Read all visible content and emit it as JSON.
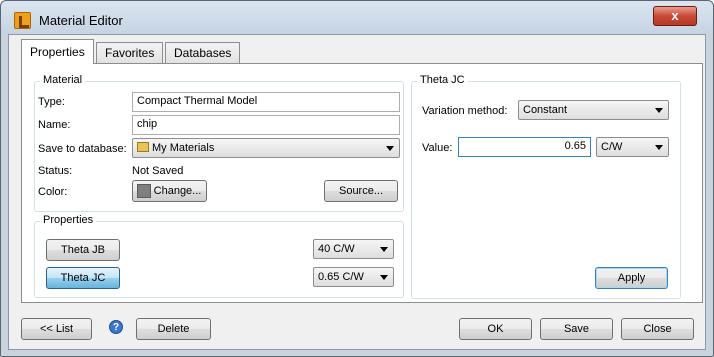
{
  "window": {
    "title": "Material Editor",
    "close_glyph": "x"
  },
  "tabs": [
    {
      "label": "Properties",
      "active": true
    },
    {
      "label": "Favorites",
      "active": false
    },
    {
      "label": "Databases",
      "active": false
    }
  ],
  "material": {
    "group_title": "Material",
    "type_label": "Type:",
    "type_value": "Compact Thermal Model",
    "name_label": "Name:",
    "name_value": "chip",
    "save_label": "Save to database:",
    "save_value": "My Materials",
    "status_label": "Status:",
    "status_value": "Not Saved",
    "color_label": "Color:",
    "change_button": "Change...",
    "source_button": "Source..."
  },
  "properties": {
    "group_title": "Properties",
    "items": [
      {
        "button": "Theta JB",
        "value": "40 C/W",
        "selected": false
      },
      {
        "button": "Theta JC",
        "value": "0.65 C/W",
        "selected": true
      }
    ]
  },
  "theta_jc": {
    "group_title": "Theta JC",
    "variation_label": "Variation method:",
    "variation_value": "Constant",
    "value_label": "Value:",
    "value": "0.65",
    "unit": "C/W",
    "apply_button": "Apply"
  },
  "footer": {
    "list_button": "<< List",
    "help_glyph": "?",
    "delete_button": "Delete",
    "ok_button": "OK",
    "save_button": "Save",
    "close_button": "Close"
  },
  "colors": {
    "swatch": "#808080",
    "accent": "#3c7fb1"
  }
}
